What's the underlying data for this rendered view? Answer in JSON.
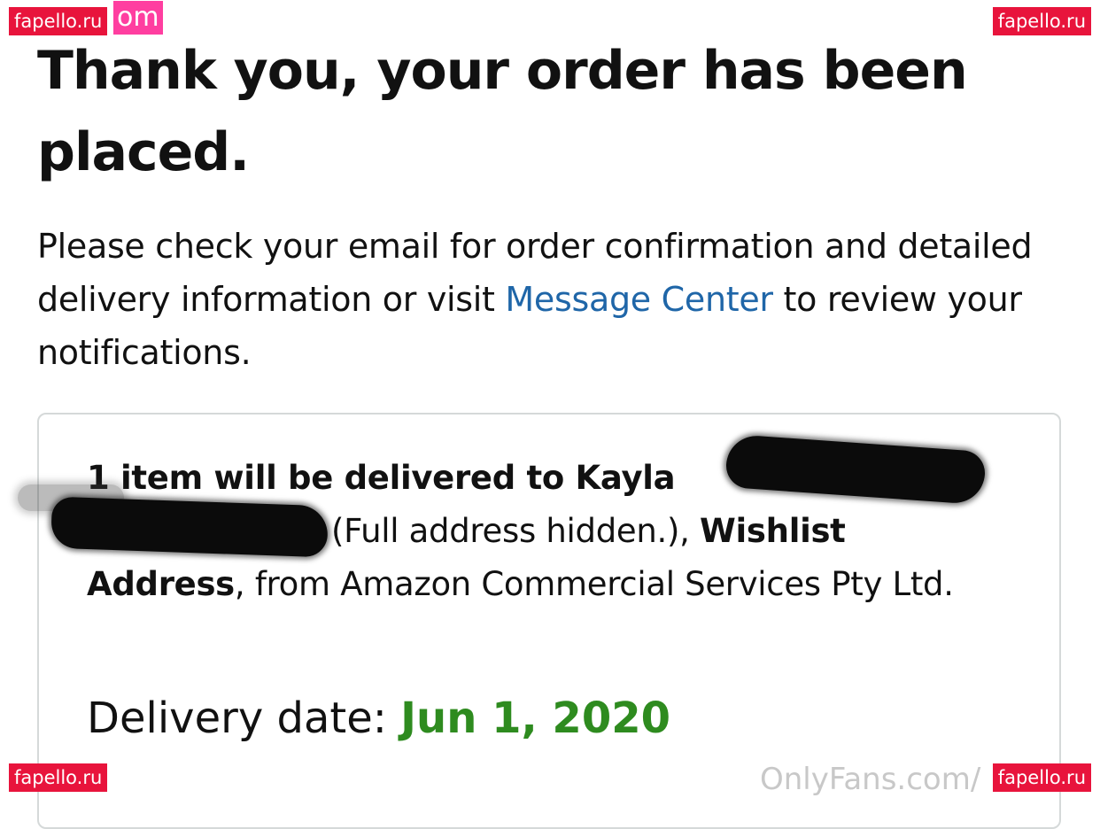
{
  "header": {
    "title": "Thank you, your order has been placed."
  },
  "intro": {
    "text_before_link": "Please check your email for order confirmation and detailed delivery information or visit ",
    "link_label": "Message Center",
    "text_after_link": " to review your notifications."
  },
  "delivery": {
    "bold_lead": "1 item will be delivered to Kayla ",
    "address_note": "(Full address hidden.), ",
    "bold_address_label": "Wishlist Address",
    "from_text": ", from Amazon Commercial Services Pty Ltd.",
    "date_label": "Delivery date: ",
    "date_value": "Jun 1, 2020"
  },
  "colors": {
    "link": "#1f66a8",
    "date_green": "#2e8b1f",
    "watermark_red": "#e8143c",
    "watermark_pink": "#ff3ea0"
  },
  "watermarks": {
    "top_left": "fapello.ru",
    "top_left_suffix": "om",
    "top_right": "fapello.ru",
    "bottom_left": "fapello.ru",
    "bottom_right": "fapello.ru",
    "onlyfans": "OnlyFans.com/"
  }
}
